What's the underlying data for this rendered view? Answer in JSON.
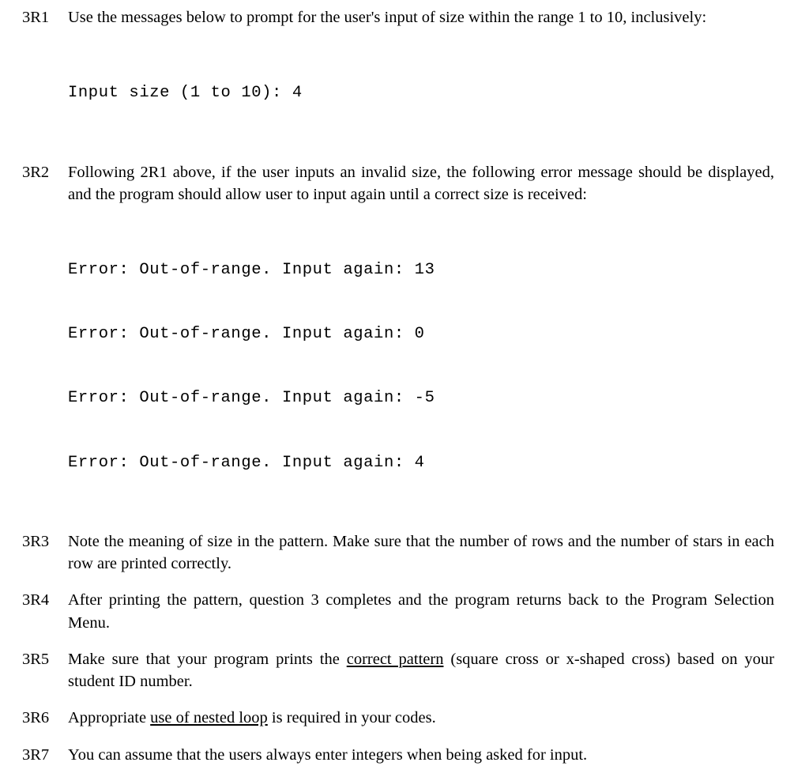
{
  "items": [
    {
      "label": "3R1",
      "text": "Use the messages below to prompt for the user's input of size within the range 1 to 10, inclusively:",
      "code": [
        "Input size (1 to 10): 4"
      ]
    },
    {
      "label": "3R2",
      "text_pre": "Following 2R1 above, if the user inputs an invalid size, the following error message should be displayed, and the program should allow user to input again until a correct size is received:",
      "code": [
        "Error: Out-of-range. Input again: 13",
        "Error: Out-of-range. Input again: 0",
        "Error: Out-of-range. Input again: -5",
        "Error: Out-of-range. Input again: 4"
      ]
    },
    {
      "label": "3R3",
      "text": "Note the meaning of size in the pattern. Make sure that the number of rows and the number of stars in each row are printed correctly."
    },
    {
      "label": "3R4",
      "text": "After printing the pattern, question 3 completes and the program returns back to the Program Selection Menu."
    },
    {
      "label": "3R5",
      "parts": [
        {
          "t": "Make sure that your program prints the "
        },
        {
          "t": "correct pattern",
          "u": true
        },
        {
          "t": " (square cross or x-shaped cross) based on your student ID number."
        }
      ]
    },
    {
      "label": "3R6",
      "parts": [
        {
          "t": "Appropriate "
        },
        {
          "t": "use of nested loop",
          "u": true
        },
        {
          "t": " is required in your codes."
        }
      ]
    },
    {
      "label": "3R7",
      "text": "You can assume that the users always enter integers when being asked for input."
    }
  ]
}
